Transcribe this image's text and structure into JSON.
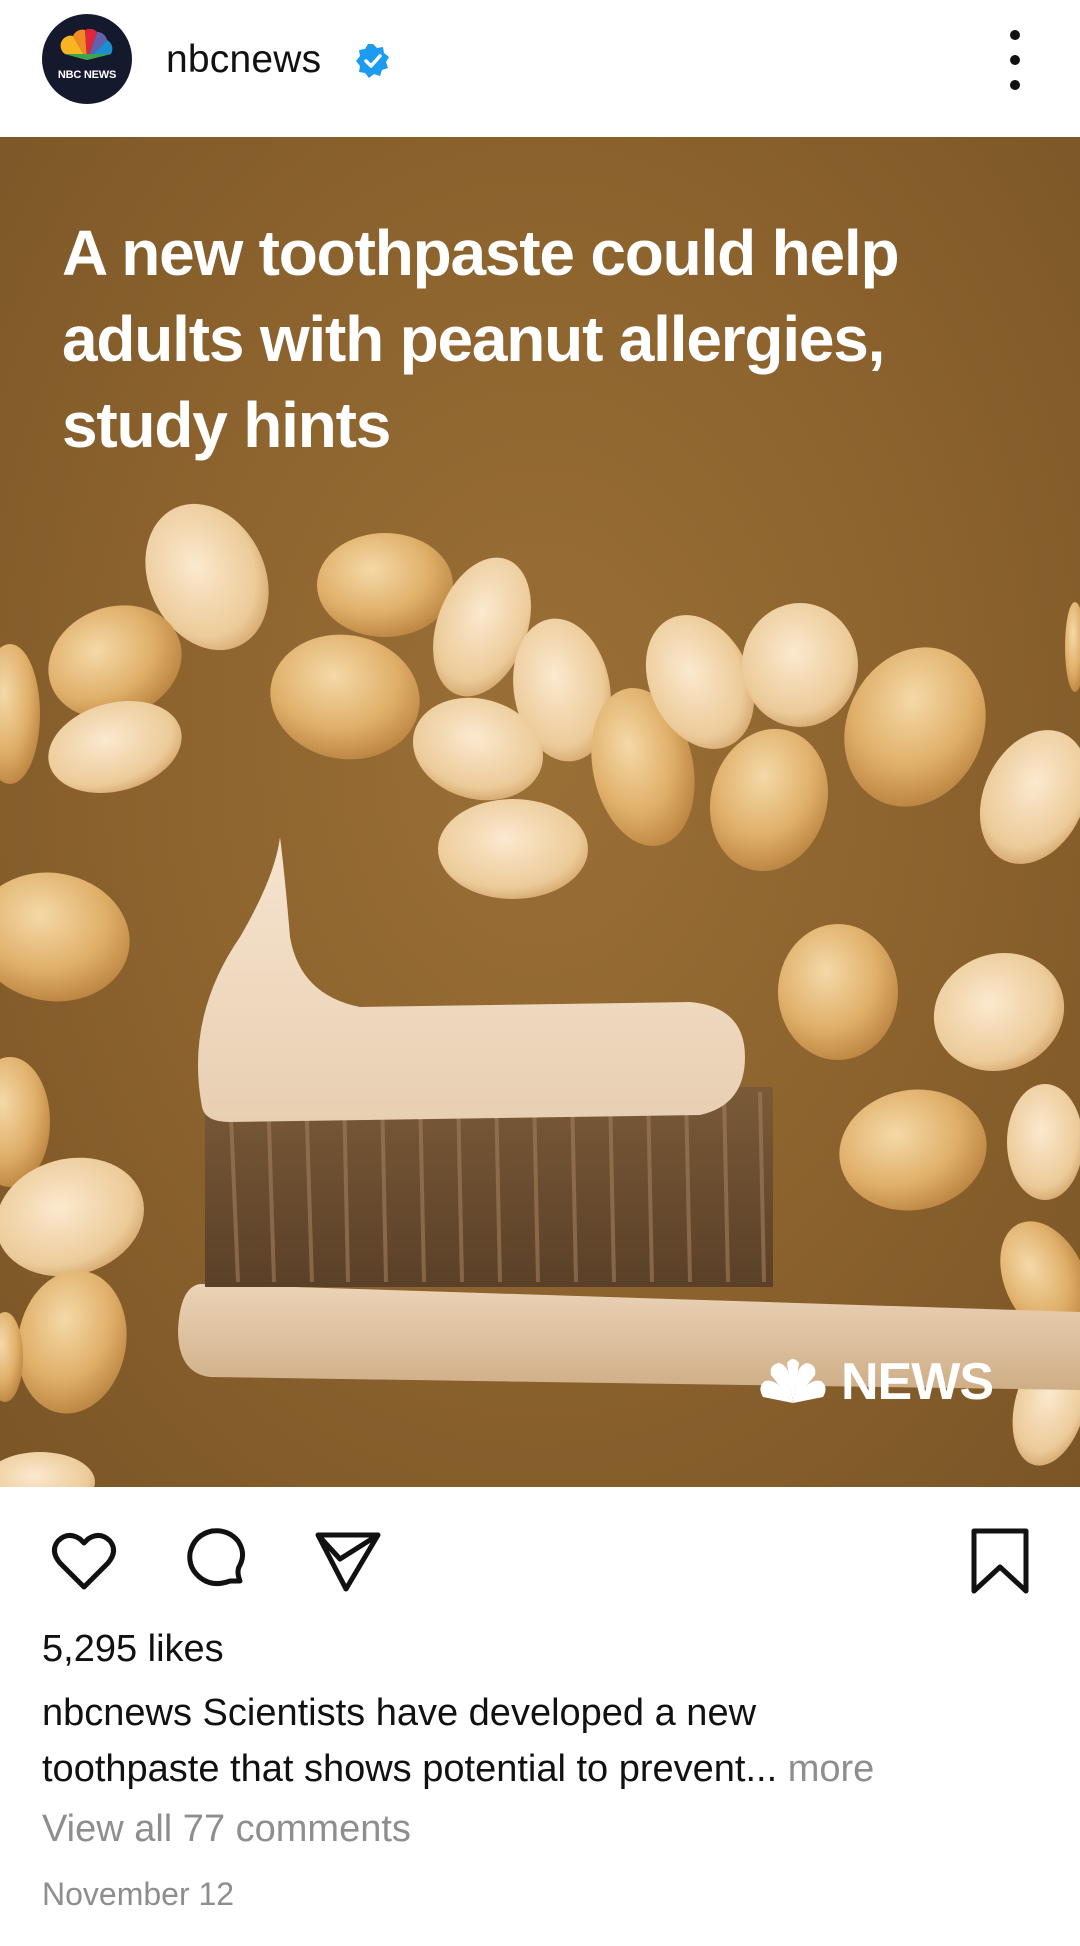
{
  "header": {
    "username": "nbcnews",
    "avatar_text": "NBC NEWS",
    "verified_icon": "verified-badge-icon",
    "more_icon": "more-options-icon"
  },
  "post": {
    "headline": "A new toothpaste could help adults with peanut allergies, study hints",
    "logo_wordmark": "NEWS",
    "image_subject": "toothbrush-with-toothpaste-and-peanuts"
  },
  "actions": {
    "like_icon": "heart-icon",
    "comment_icon": "comment-icon",
    "share_icon": "send-icon",
    "save_icon": "bookmark-icon"
  },
  "likes": "5,295 likes",
  "caption": {
    "username": "nbcnews",
    "text_line1": "Scientists have developed a new",
    "text_line2": "toothpaste that shows potential to prevent",
    "ellipsis": "...",
    "more_label": "more"
  },
  "comments_link": "View all 77 comments",
  "date": "November 12",
  "colors": {
    "background": "#ffffff",
    "text": "#111111",
    "muted": "#8e8e8e",
    "verified": "#1d9bf0",
    "image_bg": "#8b622d"
  }
}
